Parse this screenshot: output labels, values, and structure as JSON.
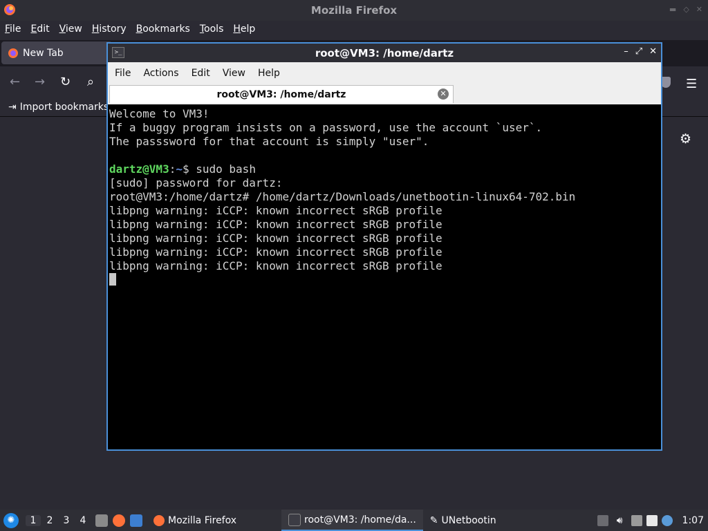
{
  "firefox": {
    "window_title": "Mozilla Firefox",
    "menu": [
      "File",
      "Edit",
      "View",
      "History",
      "Bookmarks",
      "Tools",
      "Help"
    ],
    "tab_label": "New Tab",
    "bookmark_label": "Import bookmarks..."
  },
  "terminal": {
    "window_title": "root@VM3: /home/dartz",
    "menu": [
      "File",
      "Actions",
      "Edit",
      "View",
      "Help"
    ],
    "tab_label": "root@VM3: /home/dartz",
    "lines": [
      "Welcome to VM3!",
      "If a buggy program insists on a password, use the account `user`.",
      "The passsword for that account is simply \"user\".",
      "",
      "",
      "[sudo] password for dartz:",
      "root@VM3:/home/dartz# /home/dartz/Downloads/unetbootin-linux64-702.bin",
      "libpng warning: iCCP: known incorrect sRGB profile",
      "libpng warning: iCCP: known incorrect sRGB profile",
      "libpng warning: iCCP: known incorrect sRGB profile",
      "libpng warning: iCCP: known incorrect sRGB profile",
      "libpng warning: iCCP: known incorrect sRGB profile"
    ],
    "prompt_user": "dartz@VM3",
    "prompt_sep": ":",
    "prompt_path": "~",
    "prompt_cmd": "$ sudo bash"
  },
  "taskbar": {
    "workspaces": [
      "1",
      "2",
      "3",
      "4"
    ],
    "tasks": [
      "Mozilla Firefox",
      "root@VM3: /home/da...",
      "UNetbootin"
    ],
    "clock": "1:07"
  },
  "colors": {
    "accent": "#4a90d9",
    "prompt_user": "#5fd75f",
    "prompt_path": "#5f87d7"
  }
}
